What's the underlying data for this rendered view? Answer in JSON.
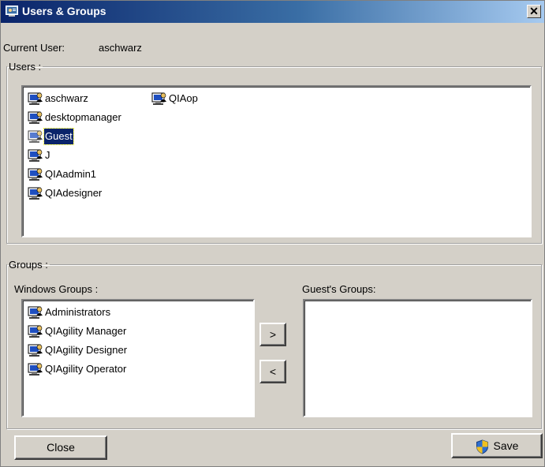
{
  "window": {
    "title": "Users & Groups",
    "close_glyph": "✕"
  },
  "current_user": {
    "label": "Current User:",
    "value": "aschwarz"
  },
  "users_group": {
    "legend": "Users :",
    "items": [
      {
        "name": "aschwarz",
        "selected": false,
        "icon": "user-computer-icon"
      },
      {
        "name": "desktopmanager",
        "selected": false,
        "icon": "user-computer-icon"
      },
      {
        "name": "Guest",
        "selected": true,
        "icon": "user-computer-icon"
      },
      {
        "name": "J",
        "selected": false,
        "icon": "user-computer-icon"
      },
      {
        "name": "QIAadmin1",
        "selected": false,
        "icon": "user-computer-icon"
      },
      {
        "name": "QIAdesigner",
        "selected": false,
        "icon": "user-computer-icon"
      },
      {
        "name": "QIAop",
        "selected": false,
        "icon": "user-computer-icon"
      }
    ]
  },
  "groups_group": {
    "legend": "Groups :",
    "windows_groups_label": "Windows Groups :",
    "windows_groups": [
      {
        "name": "Administrators",
        "icon": "group-computer-icon"
      },
      {
        "name": "QIAgility Manager",
        "icon": "group-computer-icon"
      },
      {
        "name": "QIAgility Designer",
        "icon": "group-computer-icon"
      },
      {
        "name": "QIAgility Operator",
        "icon": "group-computer-icon"
      }
    ],
    "user_groups_label": "Guest's Groups:",
    "user_groups": [],
    "add_label": ">",
    "remove_label": "<"
  },
  "footer": {
    "close_label": "Close",
    "save_label": "Save"
  },
  "colors": {
    "dialog_bg": "#d4d0c8",
    "title_start": "#0a246a",
    "title_end": "#a6caf0",
    "selection": "#0a246a"
  }
}
